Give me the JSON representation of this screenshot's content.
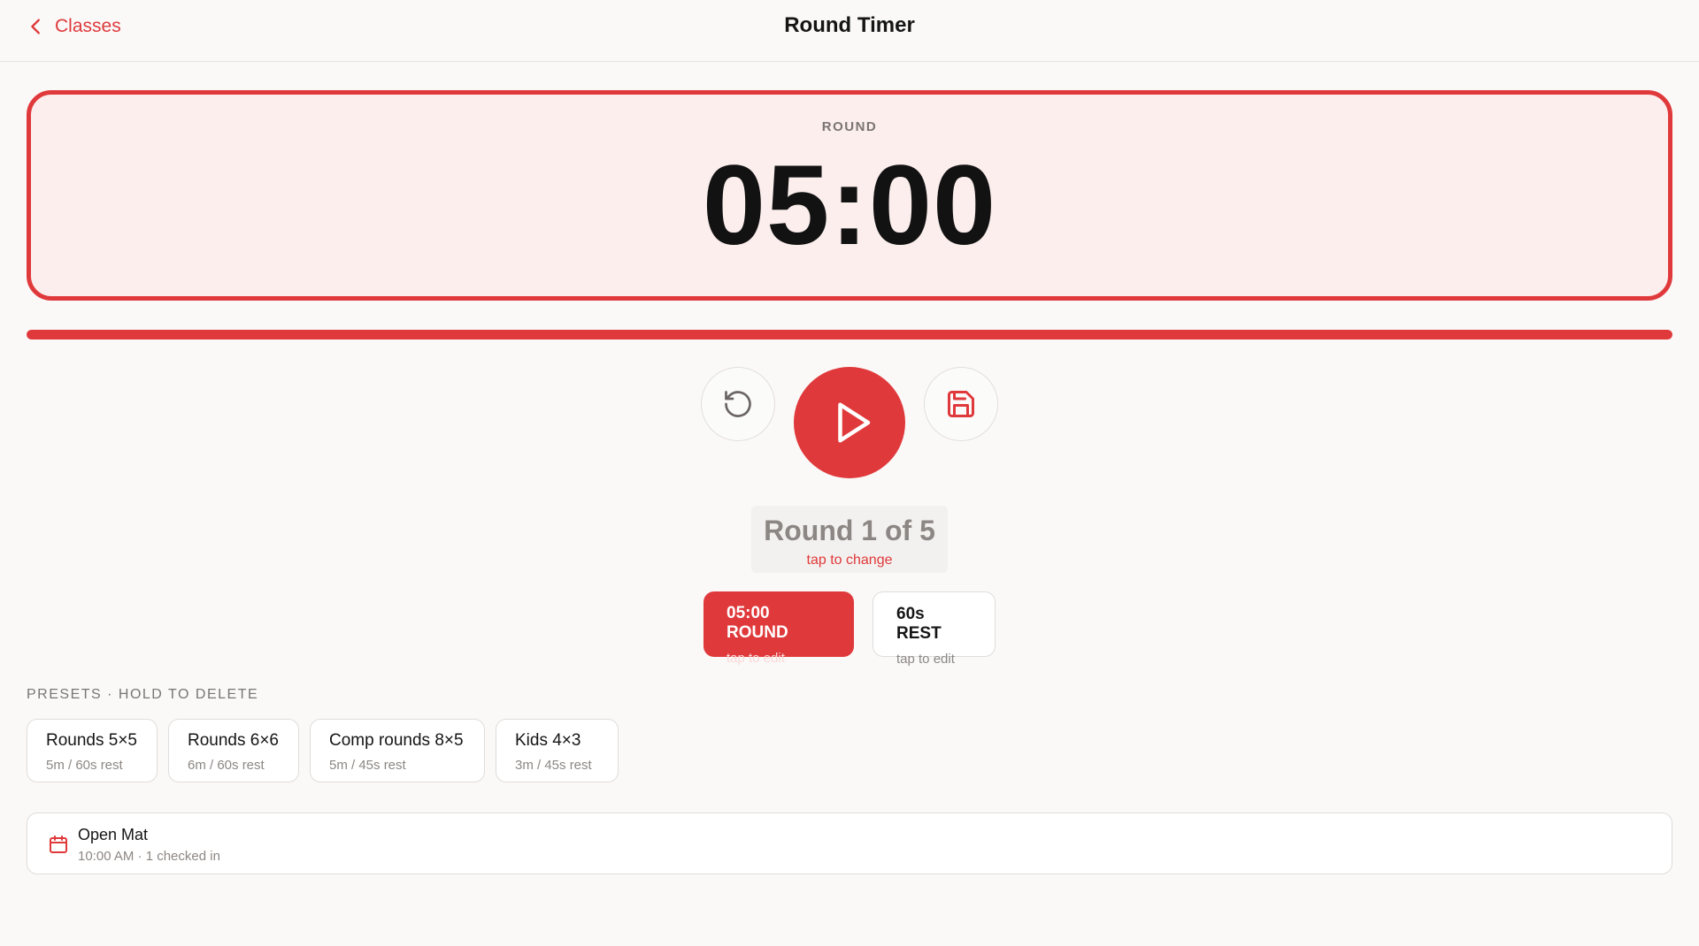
{
  "header": {
    "back_label": "Classes",
    "title": "Round Timer"
  },
  "timer": {
    "mode_label": "ROUND",
    "display": "05:00",
    "progress_fraction": 1.0
  },
  "controls": {
    "reset_icon": "rotate-ccw-icon",
    "play_icon": "play-icon",
    "save_icon": "save-icon"
  },
  "round_counter": {
    "text": "Round 1 of 5",
    "hint": "tap to change"
  },
  "settings": {
    "round": {
      "label": "05:00 ROUND",
      "hint": "tap to edit"
    },
    "rest": {
      "label": "60s REST",
      "hint": "tap to edit"
    }
  },
  "presets": {
    "heading": "PRESETS · HOLD TO DELETE",
    "items": [
      {
        "name": "Rounds 5×5",
        "detail": "5m / 60s rest"
      },
      {
        "name": "Rounds 6×6",
        "detail": "6m / 60s rest"
      },
      {
        "name": "Comp rounds 8×5",
        "detail": "5m / 45s rest"
      },
      {
        "name": "Kids 4×3",
        "detail": "3m / 45s rest"
      }
    ]
  },
  "class": {
    "icon": "calendar-icon",
    "name": "Open Mat",
    "meta": "10:00 AM · 1 checked in"
  },
  "colors": {
    "accent": "#e0393b",
    "card_tint": "#fbeeed",
    "background": "#faf9f8"
  }
}
